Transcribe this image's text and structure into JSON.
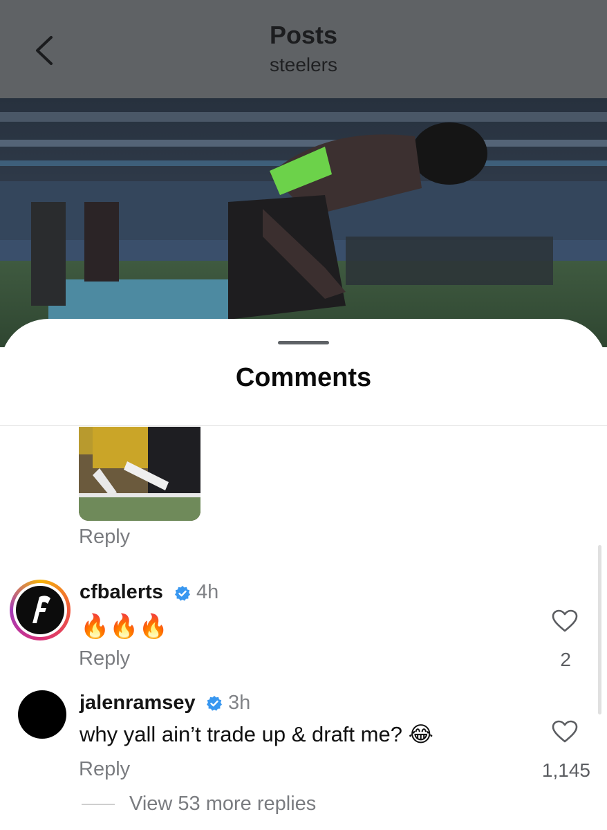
{
  "header": {
    "title": "Posts",
    "subtitle": "steelers"
  },
  "sheet": {
    "title": "Comments"
  },
  "previous_comment": {
    "reply_label": "Reply"
  },
  "comments": [
    {
      "username": "cfbalerts",
      "verified": true,
      "time": "4h",
      "text": "🔥🔥🔥",
      "reply_label": "Reply",
      "likes": "2"
    },
    {
      "username": "jalenramsey",
      "verified": true,
      "time": "3h",
      "text": "why yall ain’t trade up & draft me? 😂",
      "reply_label": "Reply",
      "likes": "1,145",
      "view_replies": "View 53 more replies"
    }
  ],
  "colors": {
    "header_bg": "#5f6265",
    "verified_blue": "#3897f0",
    "secondary_text": "#7a7c80"
  }
}
